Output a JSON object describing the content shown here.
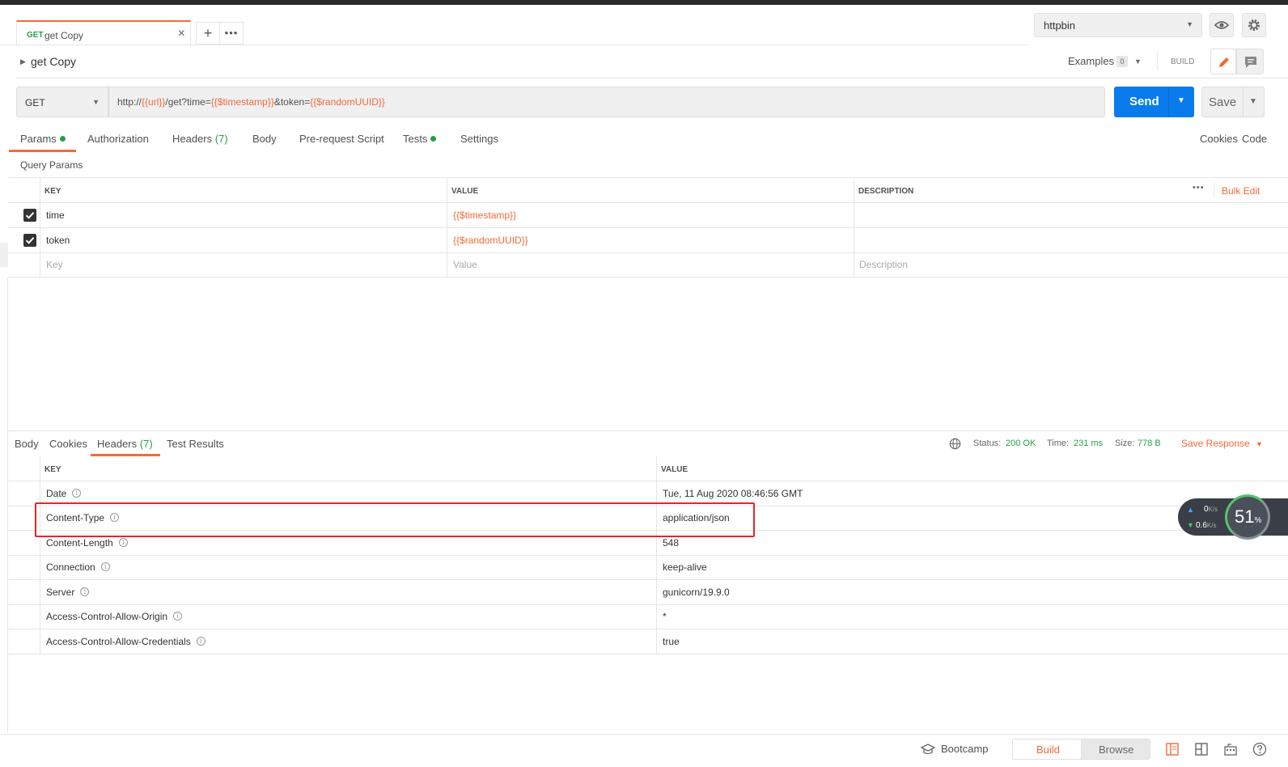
{
  "tabs": [
    {
      "method": "GET",
      "name": "get Copy"
    }
  ],
  "environment": {
    "selected": "httpbin"
  },
  "request": {
    "name": "get Copy",
    "examples_label": "Examples",
    "examples_count": "0",
    "mode_label": "BUILD",
    "method": "GET",
    "url_parts": {
      "p1": "http://",
      "p2": "{{url}}",
      "p3": "/get?time=",
      "p4": "{{$timestamp}}",
      "p5": "&token=",
      "p6": "{{$randomUUID}}"
    },
    "send_label": "Send",
    "save_label": "Save"
  },
  "request_tabs": {
    "params": "Params",
    "authorization": "Authorization",
    "headers": "Headers",
    "headers_count": "(7)",
    "body": "Body",
    "prerequest": "Pre-request Script",
    "tests": "Tests",
    "settings": "Settings",
    "cookies_link": "Cookies",
    "code_link": "Code"
  },
  "params": {
    "section_title": "Query Params",
    "col_key": "KEY",
    "col_value": "VALUE",
    "col_description": "DESCRIPTION",
    "bulk_edit": "Bulk Edit",
    "rows": [
      {
        "key": "time",
        "value": "{{$timestamp}}",
        "checked": true
      },
      {
        "key": "token",
        "value": "{{$randomUUID}}",
        "checked": true
      }
    ],
    "placeholder_key": "Key",
    "placeholder_value": "Value",
    "placeholder_description": "Description"
  },
  "response_tabs": {
    "body": "Body",
    "cookies": "Cookies",
    "headers": "Headers",
    "headers_count": "(7)",
    "test_results": "Test Results"
  },
  "response_meta": {
    "status_label": "Status:",
    "status_value": "200 OK",
    "time_label": "Time:",
    "time_value": "231 ms",
    "size_label": "Size:",
    "size_value": "778 B",
    "save_response": "Save Response"
  },
  "response_headers": {
    "col_key": "KEY",
    "col_value": "VALUE",
    "rows": [
      {
        "key": "Date",
        "value": "Tue, 11 Aug 2020 08:46:56 GMT"
      },
      {
        "key": "Content-Type",
        "value": "application/json"
      },
      {
        "key": "Content-Length",
        "value": "548"
      },
      {
        "key": "Connection",
        "value": "keep-alive"
      },
      {
        "key": "Server",
        "value": "gunicorn/19.9.0"
      },
      {
        "key": "Access-Control-Allow-Origin",
        "value": "*"
      },
      {
        "key": "Access-Control-Allow-Credentials",
        "value": "true"
      }
    ]
  },
  "net_widget": {
    "up": "0",
    "up_unit": "K/s",
    "down": "0.6",
    "down_unit": "K/s",
    "percent": "51",
    "percent_sign": "%"
  },
  "footer": {
    "bootcamp": "Bootcamp",
    "build": "Build",
    "browse": "Browse"
  },
  "colors": {
    "accent": "#f26b3a",
    "send": "#097bed",
    "success": "#26a047",
    "highlight": "#e8252a"
  }
}
